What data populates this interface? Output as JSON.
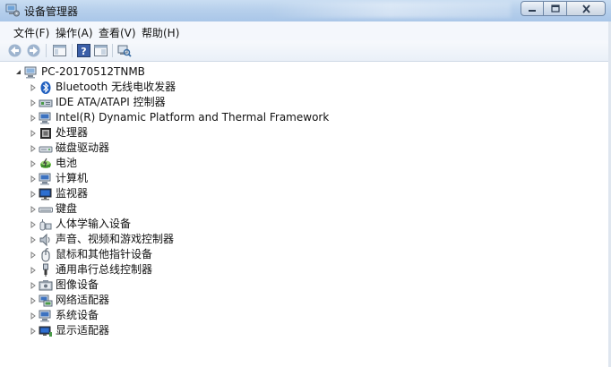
{
  "window": {
    "title": "设备管理器",
    "controls": {
      "minimize": "minimize",
      "maximize": "maximize",
      "close": "close"
    }
  },
  "menu": [
    "文件(F)",
    "操作(A)",
    "查看(V)",
    "帮助(H)"
  ],
  "toolbar": {
    "buttons": [
      "back-arrow",
      "forward-arrow",
      "properties",
      "help",
      "console-tree",
      "scan-hardware"
    ]
  },
  "tree": {
    "root": "PC-20170512TNMB",
    "categories": [
      {
        "label": "Bluetooth 无线电收发器",
        "icon": "bluetooth-icon"
      },
      {
        "label": "IDE ATA/ATAPI 控制器",
        "icon": "ide-controller-icon"
      },
      {
        "label": "Intel(R) Dynamic Platform and Thermal Framework",
        "icon": "computer-icon"
      },
      {
        "label": "处理器",
        "icon": "processor-icon"
      },
      {
        "label": "磁盘驱动器",
        "icon": "disk-drive-icon"
      },
      {
        "label": "电池",
        "icon": "battery-icon"
      },
      {
        "label": "计算机",
        "icon": "computer-icon"
      },
      {
        "label": "监视器",
        "icon": "monitor-icon"
      },
      {
        "label": "键盘",
        "icon": "keyboard-icon"
      },
      {
        "label": "人体学输入设备",
        "icon": "hid-icon"
      },
      {
        "label": "声音、视频和游戏控制器",
        "icon": "sound-icon"
      },
      {
        "label": "鼠标和其他指针设备",
        "icon": "mouse-icon"
      },
      {
        "label": "通用串行总线控制器",
        "icon": "usb-icon"
      },
      {
        "label": "图像设备",
        "icon": "camera-icon"
      },
      {
        "label": "网络适配器",
        "icon": "network-adapter-icon"
      },
      {
        "label": "系统设备",
        "icon": "system-device-icon"
      },
      {
        "label": "显示适配器",
        "icon": "display-adapter-icon"
      }
    ]
  }
}
